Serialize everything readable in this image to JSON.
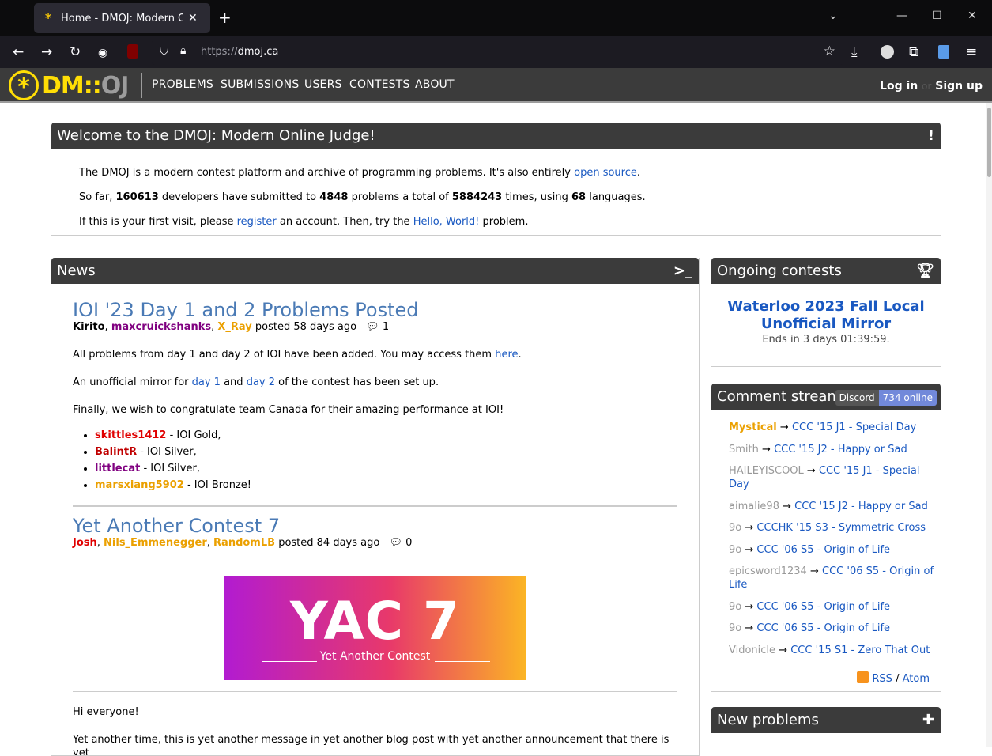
{
  "browser": {
    "tab_title": "Home - DMOJ: Modern Online Judge",
    "url_prefix": "https://",
    "url_host": "dmoj.ca"
  },
  "site": {
    "logo_dm": "DM",
    "logo_sep": "::",
    "logo_oj": "OJ",
    "nav": [
      "PROBLEMS",
      "SUBMISSIONS",
      "USERS",
      "CONTESTS",
      "ABOUT"
    ],
    "login": "Log in",
    "or": "or",
    "signup": "Sign up"
  },
  "welcome": {
    "title": "Welcome to the DMOJ: Modern Online Judge!",
    "line1_a": "The DMOJ is a modern contest platform and archive of programming problems. It's also entirely ",
    "line1_link": "open source",
    "line1_b": ".",
    "line2_a": "So far, ",
    "developers": "160613",
    "line2_b": " developers have submitted to ",
    "problems": "4848",
    "line2_c": " problems a total of ",
    "total": "5884243",
    "line2_d": " times, using ",
    "langs": "68",
    "line2_e": " languages.",
    "line3_a": "If this is your first visit, please ",
    "line3_link1": "register",
    "line3_b": " an account. Then, try the ",
    "line3_link2": "Hello, World!",
    "line3_c": " problem."
  },
  "news": {
    "title": "News",
    "posts": [
      {
        "title": "IOI '23 Day 1 and 2 Problems Posted",
        "authors": [
          {
            "name": "Kirito",
            "color": "#000000"
          },
          {
            "name": "maxcruickshanks",
            "color": "#800080"
          },
          {
            "name": "X_Ray",
            "color": "#eba000"
          }
        ],
        "posted": "posted 58 days ago",
        "comments": "1",
        "p1_a": "All problems from day 1 and day 2 of IOI have been added. You may access them ",
        "p1_link": "here",
        "p1_b": ".",
        "p2_a": "An unofficial mirror for ",
        "p2_l1": "day 1",
        "p2_b": " and ",
        "p2_l2": "day 2",
        "p2_c": " of the contest has been set up.",
        "p3": "Finally, we wish to congratulate team Canada for their amazing performance at IOI!",
        "medals": [
          {
            "user": "skittles1412",
            "color": "#e00000",
            "award": " - IOI Gold,"
          },
          {
            "user": "BalintR",
            "color": "#c00000",
            "award": " - IOI Silver,"
          },
          {
            "user": "littlecat",
            "color": "#800080",
            "award": " - IOI Silver,"
          },
          {
            "user": "marsxiang5902",
            "color": "#eba000",
            "award": " - IOI Bronze!"
          }
        ]
      },
      {
        "title": "Yet Another Contest 7",
        "authors": [
          {
            "name": "Josh",
            "color": "#e00000"
          },
          {
            "name": "Nils_Emmenegger",
            "color": "#eba000"
          },
          {
            "name": "RandomLB",
            "color": "#eba000"
          }
        ],
        "posted": "posted 84 days ago",
        "comments": "0",
        "banner_big": "YAC 7",
        "banner_sub": "Yet Another Contest",
        "p1": "Hi everyone!",
        "p2": "Yet another time, this is yet another message in yet another blog post with yet another announcement that there is yet"
      }
    ]
  },
  "ongoing": {
    "title": "Ongoing contests",
    "contest_name": "Waterloo 2023 Fall Local Unofficial Mirror",
    "ends": "Ends in 3 days 01:39:59."
  },
  "stream": {
    "title": "Comment stream",
    "discord": "Discord",
    "online": "734 online",
    "items": [
      {
        "user": "Mystical",
        "ucolor": "#eba000",
        "bold": true,
        "target": "CCC '15 J1 - Special Day"
      },
      {
        "user": "Smith",
        "ucolor": "#999999",
        "bold": false,
        "target": "CCC '15 J2 - Happy or Sad"
      },
      {
        "user": "HAILEYISCOOL",
        "ucolor": "#999999",
        "bold": false,
        "target": "CCC '15 J1 - Special Day"
      },
      {
        "user": "aimalie98",
        "ucolor": "#999999",
        "bold": false,
        "target": "CCC '15 J2 - Happy or Sad"
      },
      {
        "user": "9o",
        "ucolor": "#999999",
        "bold": false,
        "target": "CCCHK '15 S3 - Symmetric Cross"
      },
      {
        "user": "9o",
        "ucolor": "#999999",
        "bold": false,
        "target": "CCC '06 S5 - Origin of Life"
      },
      {
        "user": "epicsword1234",
        "ucolor": "#999999",
        "bold": false,
        "target": "CCC '06 S5 - Origin of Life"
      },
      {
        "user": "9o",
        "ucolor": "#999999",
        "bold": false,
        "target": "CCC '06 S5 - Origin of Life"
      },
      {
        "user": "9o",
        "ucolor": "#999999",
        "bold": false,
        "target": "CCC '06 S5 - Origin of Life"
      },
      {
        "user": "Vidonicle",
        "ucolor": "#999999",
        "bold": false,
        "target": "CCC '15 S1 - Zero That Out"
      }
    ],
    "rss": "RSS",
    "slash": "/",
    "atom": "Atom"
  },
  "newproblems": {
    "title": "New problems"
  },
  "arrow": "→",
  "comma": ", ",
  "excl": "!",
  "prompt": ">_"
}
